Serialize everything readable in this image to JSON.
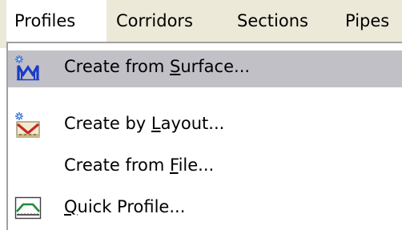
{
  "menubar": {
    "items": [
      {
        "label": "Profiles"
      },
      {
        "label": "Corridors"
      },
      {
        "label": "Sections"
      },
      {
        "label": "Pipes"
      }
    ]
  },
  "dropdown": {
    "items": [
      {
        "pre": "Create from ",
        "accel": "S",
        "post": "urface...",
        "icon": "profile-from-surface-icon"
      },
      {
        "pre": "Create by ",
        "accel": "L",
        "post": "ayout...",
        "icon": "profile-by-layout-icon"
      },
      {
        "pre": "Create from ",
        "accel": "F",
        "post": "ile...",
        "icon": ""
      },
      {
        "pre": "",
        "accel": "Q",
        "post": "uick Profile...",
        "icon": "quick-profile-icon"
      }
    ]
  },
  "colors": {
    "menubar_bg": "#ece9d8",
    "highlight": "#c1c0c7",
    "icon_blue": "#1a3cc8",
    "icon_red": "#c82828",
    "icon_green": "#1e8c3c"
  }
}
